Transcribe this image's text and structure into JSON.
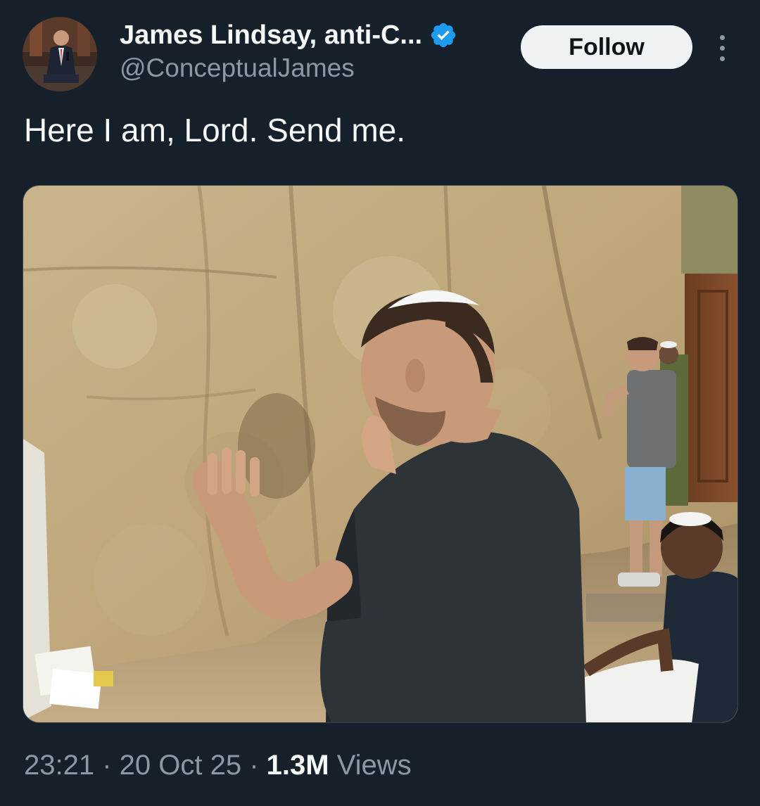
{
  "author": {
    "display_name": "James Lindsay, anti-C...",
    "handle": "@ConceptualJames",
    "verified": true,
    "verified_color": "#1d9bf0",
    "avatar_icon": "profile-photo"
  },
  "actions": {
    "follow_label": "Follow",
    "more_icon": "more-vertical-icon"
  },
  "tweet": {
    "text": "Here I am, Lord. Send me.",
    "media": {
      "type": "photo",
      "alt": "Man in black t-shirt and white kippah praying with hands on a large stone wall; other men praying nearby"
    }
  },
  "meta": {
    "time": "23:21",
    "sep1": " · ",
    "date": "20 Oct 25",
    "sep2": " · ",
    "views_count": "1.3M",
    "views_label": " Views"
  },
  "colors": {
    "background": "#15202b",
    "primary_text": "#f7f9f9",
    "secondary_text": "#8b98a5",
    "follow_bg": "#eff3f4"
  }
}
